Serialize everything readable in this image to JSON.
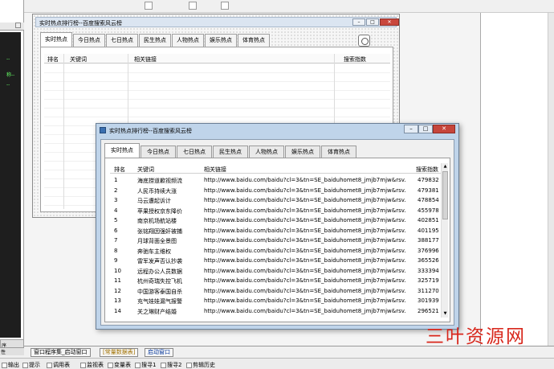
{
  "ide": {
    "left_panel": {
      "tab1": "序",
      "tab2": "性",
      "code_marks": [
        "--",
        "称--",
        "--"
      ]
    },
    "bottom_tabs": [
      "窗口程序集_启动窗口",
      "[常量数据表]",
      "启动窗口"
    ],
    "status_items": [
      "输出",
      "提示",
      "调用表",
      "监视表",
      "变量表",
      "搜寻1",
      "搜寻2",
      "剪辑历史"
    ]
  },
  "design_form": {
    "title": "实时热点排行榜--百度搜索风云榜",
    "tabs": [
      "实时热点",
      "今日热点",
      "七日热点",
      "民生热点",
      "人物热点",
      "娱乐热点",
      "体育热点"
    ],
    "columns": [
      "排名",
      "关键词",
      "相关链接",
      "搜索指数"
    ]
  },
  "run_window": {
    "title": "实时热点排行榜--百度搜索风云榜",
    "tabs": [
      "实时热点",
      "今日热点",
      "七日热点",
      "民生热点",
      "人物热点",
      "娱乐热点",
      "体育热点"
    ],
    "columns": [
      "排名",
      "关键词",
      "相关链接",
      "搜索指数"
    ],
    "rows": [
      {
        "rank": "1",
        "keyword": "海底捞道歉视频流",
        "link": "http://www.baidu.com/baidu?cl=3&tn=SE_baiduhomet8_jmjb7mjw&rsv...",
        "count": "479832"
      },
      {
        "rank": "2",
        "keyword": "人民币持续大涨",
        "link": "http://www.baidu.com/baidu?cl=3&tn=SE_baiduhomet8_jmjb7mjw&rsv...",
        "count": "479381"
      },
      {
        "rank": "3",
        "keyword": "马云遭起诉计",
        "link": "http://www.baidu.com/baidu?cl=3&tn=SE_baiduhomet8_jmjb7mjw&rsv...",
        "count": "478854"
      },
      {
        "rank": "4",
        "keyword": "苹果授权京东降价",
        "link": "http://www.baidu.com/baidu?cl=3&tn=SE_baiduhomet8_jmjb7mjw&rsv...",
        "count": "455978"
      },
      {
        "rank": "5",
        "keyword": "南京机场航站楼",
        "link": "http://www.baidu.com/baidu?cl=3&tn=SE_baiduhomet8_jmjb7mjw&rsv...",
        "count": "402851"
      },
      {
        "rank": "6",
        "keyword": "张铭翔因强奸被捕",
        "link": "http://www.baidu.com/baidu?cl=3&tn=SE_baiduhomet8_jmjb7mjw&rsv...",
        "count": "401195"
      },
      {
        "rank": "7",
        "keyword": "月球背面全景图",
        "link": "http://www.baidu.com/baidu?cl=3&tn=SE_baiduhomet8_jmjb7mjw&rsv...",
        "count": "388177"
      },
      {
        "rank": "8",
        "keyword": "奔驰车主维权",
        "link": "http://www.baidu.com/baidu?cl=3&tn=SE_baiduhomet8_jmjb7mjw&rsv...",
        "count": "376996"
      },
      {
        "rank": "9",
        "keyword": "雷军发声否认抄袭",
        "link": "http://www.baidu.com/baidu?cl=3&tn=SE_baiduhomet8_jmjb7mjw&rsv...",
        "count": "365526"
      },
      {
        "rank": "10",
        "keyword": "远程办公人员数据",
        "link": "http://www.baidu.com/baidu?cl=3&tn=SE_baiduhomet8_jmjb7mjw&rsv...",
        "count": "333394"
      },
      {
        "rank": "11",
        "keyword": "杭州奇瑞失控飞机",
        "link": "http://www.baidu.com/baidu?cl=3&tn=SE_baiduhomet8_jmjb7mjw&rsv...",
        "count": "325719"
      },
      {
        "rank": "12",
        "keyword": "中国游客泰国自杀",
        "link": "http://www.baidu.com/baidu?cl=3&tn=SE_baiduhomet8_jmjb7mjw&rsv...",
        "count": "311270"
      },
      {
        "rank": "13",
        "keyword": "充气娃娃漏气报警",
        "link": "http://www.baidu.com/baidu?cl=3&tn=SE_baiduhomet8_jmjb7mjw&rsv...",
        "count": "301939"
      },
      {
        "rank": "14",
        "keyword": "关之琳财产结婚",
        "link": "http://www.baidu.com/baidu?cl=3&tn=SE_baiduhomet8_jmjb7mjw&rsv...",
        "count": "296521"
      }
    ]
  },
  "watermark": "三叶资源网"
}
